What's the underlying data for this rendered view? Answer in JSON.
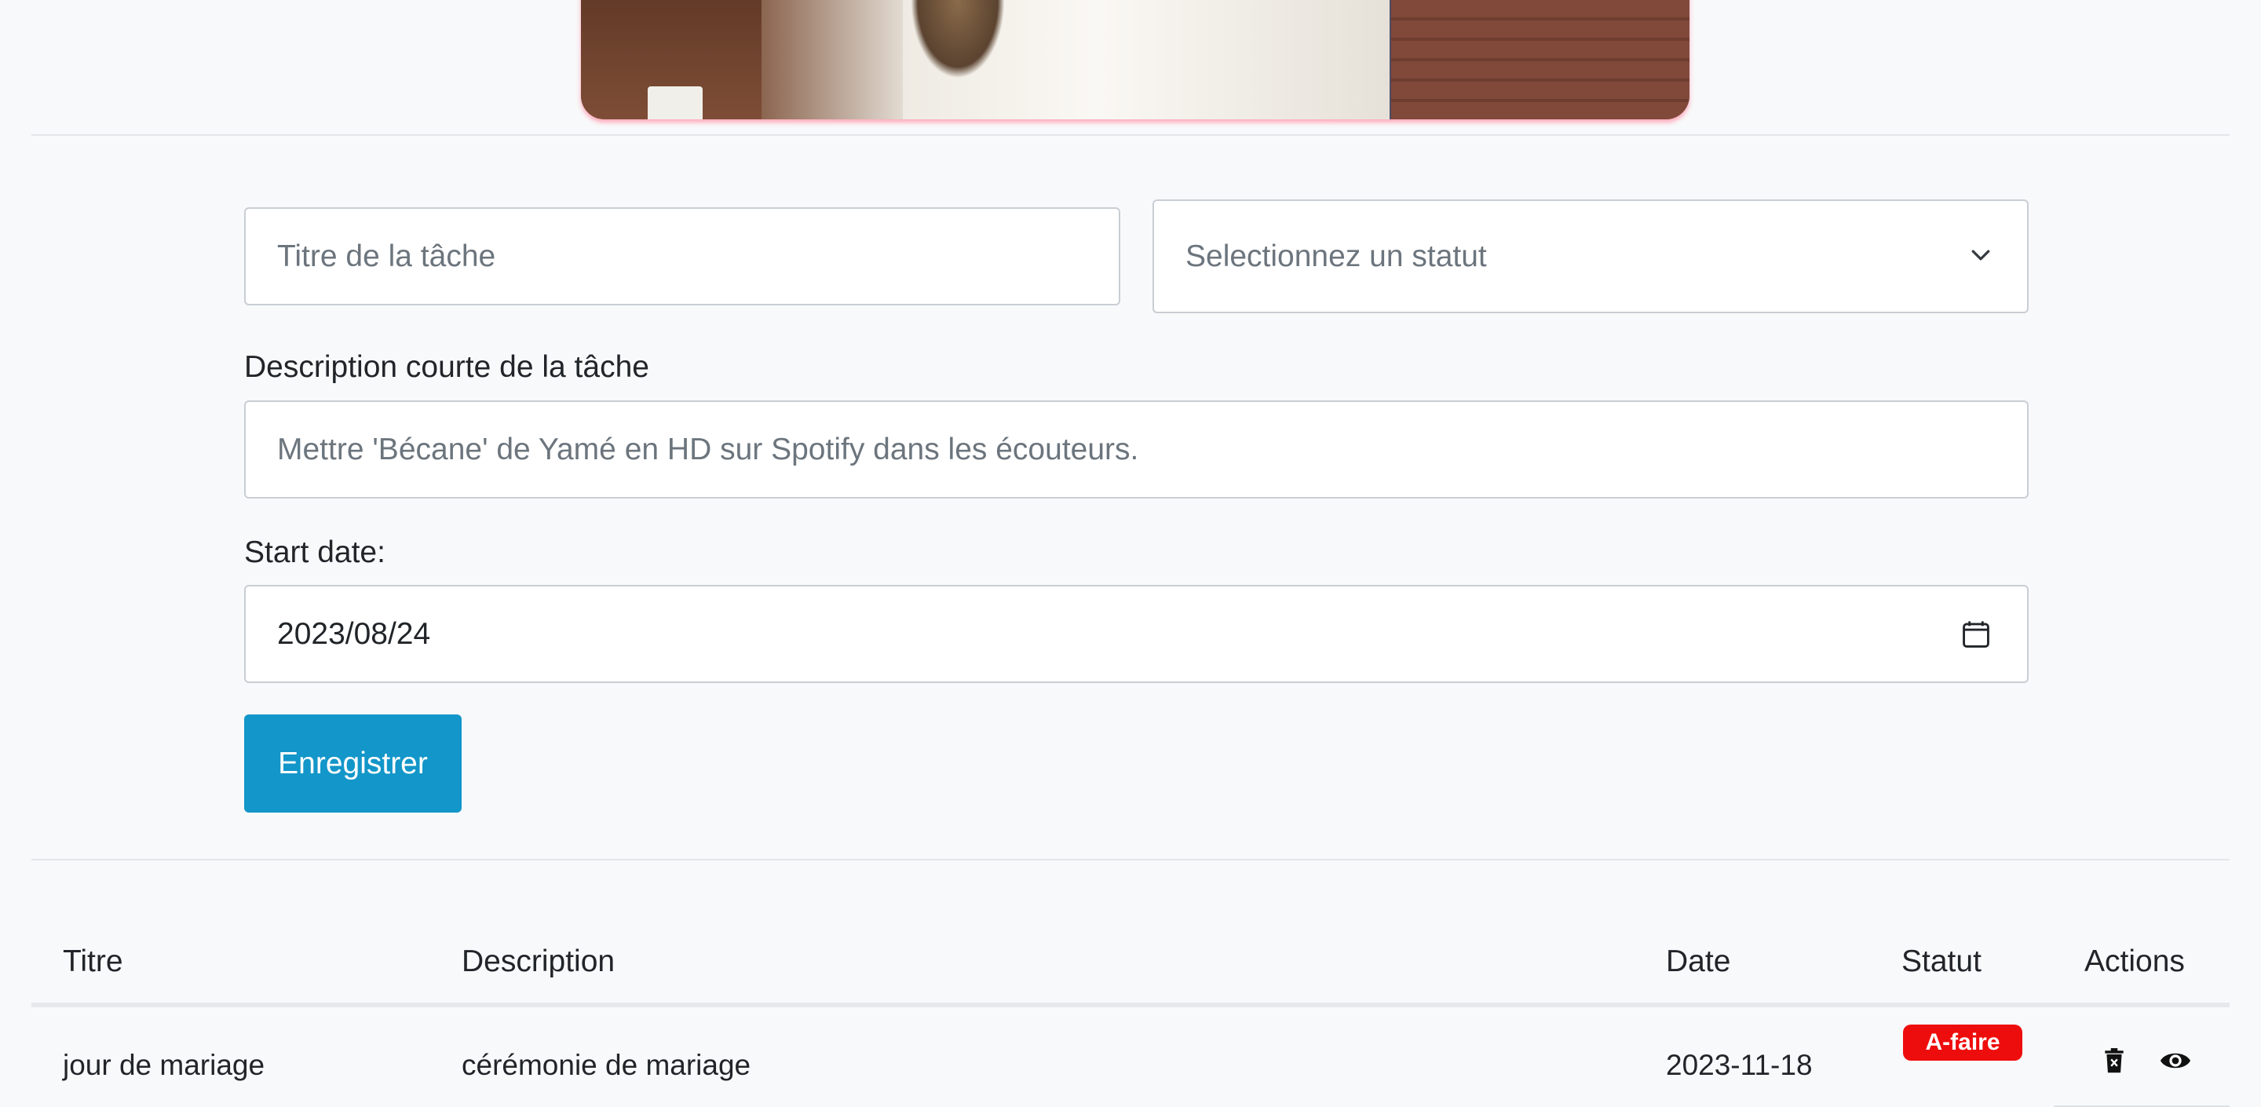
{
  "form": {
    "title_placeholder": "Titre de la tâche",
    "status_placeholder": "Selectionnez un statut",
    "description_label": "Description courte de la tâche",
    "description_placeholder": "Mettre 'Bécane' de Yamé en HD sur Spotify dans les écouteurs.",
    "start_date_label": "Start date:",
    "start_date_value": "2023/08/24",
    "save_label": "Enregistrer"
  },
  "table": {
    "headers": {
      "titre": "Titre",
      "description": "Description",
      "date": "Date",
      "statut": "Statut",
      "actions": "Actions"
    },
    "rows": [
      {
        "titre": "jour de mariage",
        "description": "cérémonie de mariage",
        "date": "2023-11-18",
        "statut": "A-faire"
      }
    ]
  },
  "icons": {
    "select": "chevron-down-icon",
    "date": "calendar-icon",
    "delete": "trash-icon",
    "view": "eye-icon"
  },
  "colors": {
    "primary_button": "#1396c9",
    "status_badge": "#ee0d0d"
  }
}
